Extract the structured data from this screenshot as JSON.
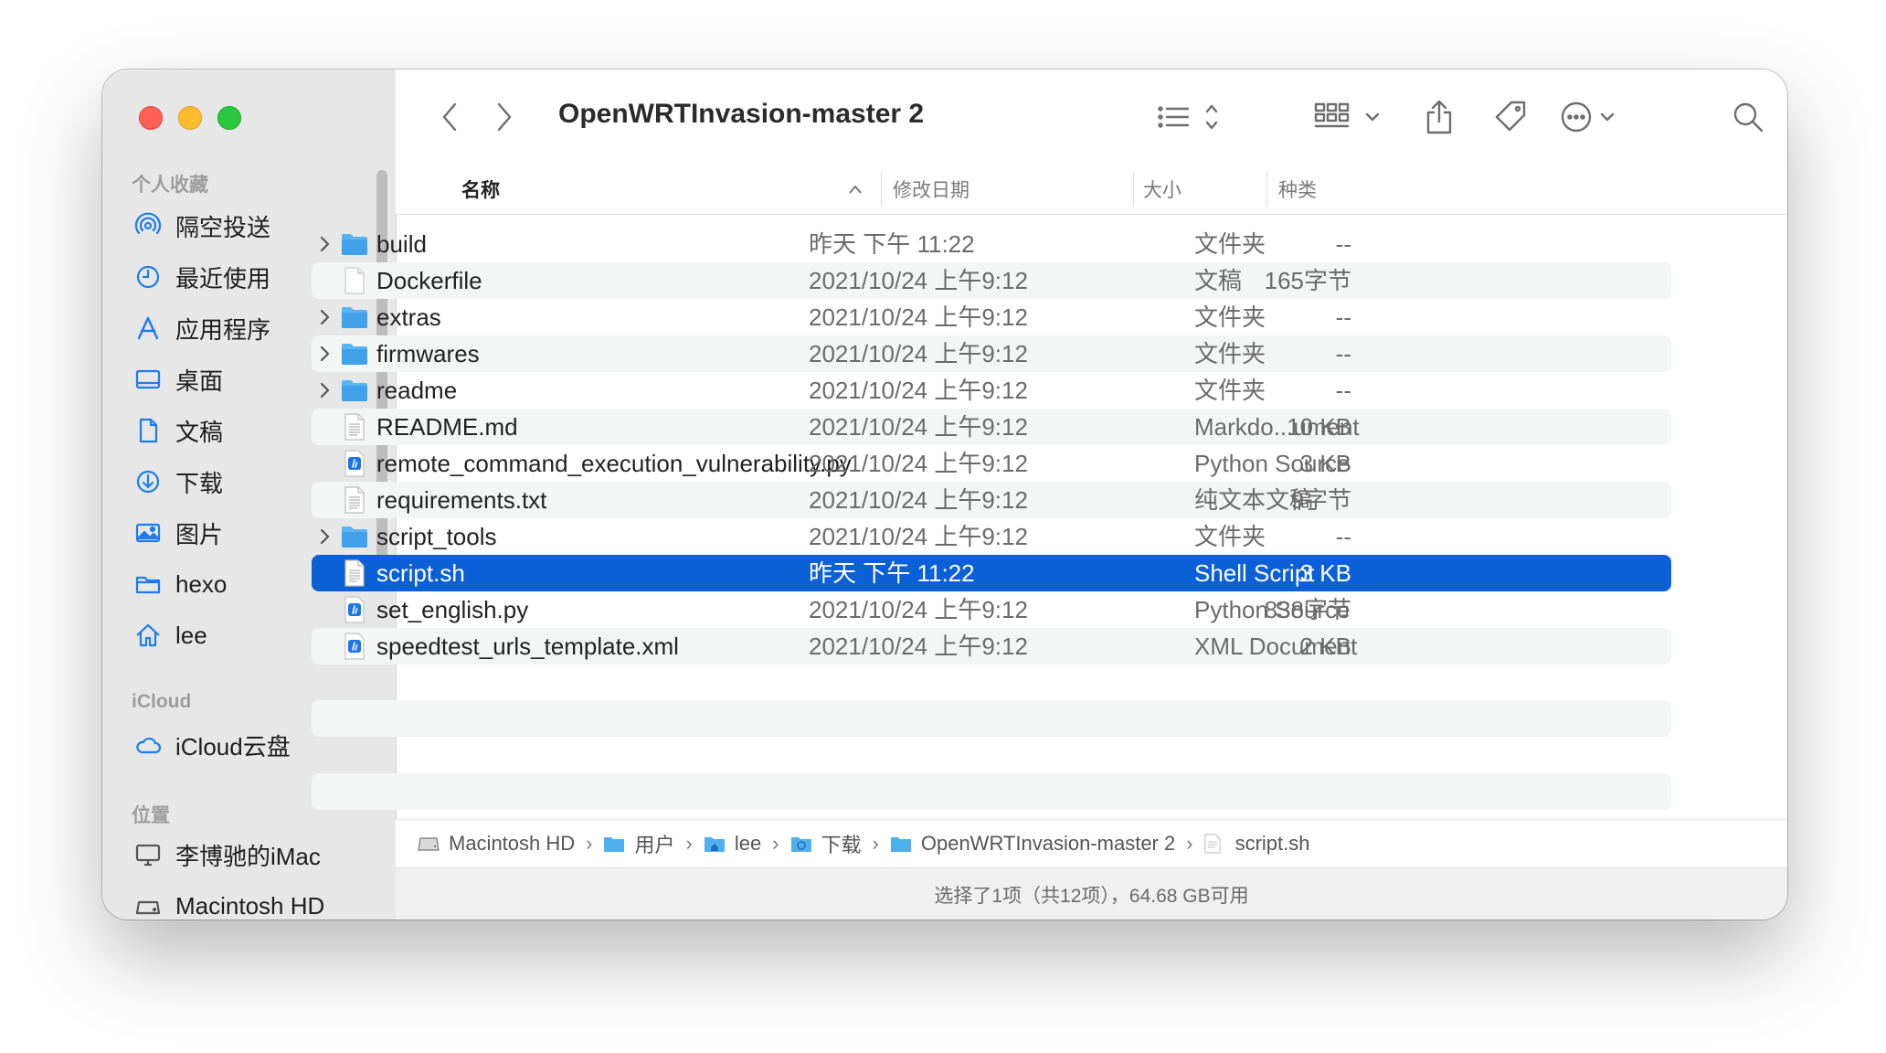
{
  "window": {
    "title": "OpenWRTInvasion-master 2"
  },
  "sidebar": {
    "sections": [
      {
        "label": "个人收藏"
      },
      {
        "label": "iCloud"
      },
      {
        "label": "位置"
      }
    ],
    "favorites": [
      {
        "label": "隔空投送",
        "icon": "airdrop-icon"
      },
      {
        "label": "最近使用",
        "icon": "clock-icon"
      },
      {
        "label": "应用程序",
        "icon": "applications-icon"
      },
      {
        "label": "桌面",
        "icon": "desktop-icon"
      },
      {
        "label": "文稿",
        "icon": "document-icon"
      },
      {
        "label": "下载",
        "icon": "download-icon"
      },
      {
        "label": "图片",
        "icon": "photos-icon"
      },
      {
        "label": "hexo",
        "icon": "folder-icon"
      },
      {
        "label": "lee",
        "icon": "home-icon"
      }
    ],
    "icloud": [
      {
        "label": "iCloud云盘",
        "icon": "cloud-icon"
      }
    ],
    "locations": [
      {
        "label": "李博驰的iMac",
        "icon": "computer-icon"
      },
      {
        "label": "Macintosh HD",
        "icon": "disk-icon"
      }
    ]
  },
  "columns": {
    "name": "名称",
    "date": "修改日期",
    "size": "大小",
    "kind": "种类"
  },
  "files": [
    {
      "name": "build",
      "date": "昨天 下午 11:22",
      "size": "--",
      "kind": "文件夹",
      "type": "folder",
      "selected": false
    },
    {
      "name": "Dockerfile",
      "date": "2021/10/24 上午9:12",
      "size": "165字节",
      "kind": "文稿",
      "type": "blank",
      "selected": false
    },
    {
      "name": "extras",
      "date": "2021/10/24 上午9:12",
      "size": "--",
      "kind": "文件夹",
      "type": "folder",
      "selected": false
    },
    {
      "name": "firmwares",
      "date": "2021/10/24 上午9:12",
      "size": "--",
      "kind": "文件夹",
      "type": "folder",
      "selected": false
    },
    {
      "name": "readme",
      "date": "2021/10/24 上午9:12",
      "size": "--",
      "kind": "文件夹",
      "type": "folder",
      "selected": false
    },
    {
      "name": "README.md",
      "date": "2021/10/24 上午9:12",
      "size": "10 KB",
      "kind": "Markdo...ument",
      "type": "text",
      "selected": false
    },
    {
      "name": "remote_command_execution_vulnerability.py",
      "date": "2021/10/24 上午9:12",
      "size": "3 KB",
      "kind": "Python Source",
      "type": "code",
      "selected": false
    },
    {
      "name": "requirements.txt",
      "date": "2021/10/24 上午9:12",
      "size": "9字节",
      "kind": "纯文本文稿",
      "type": "text",
      "selected": false
    },
    {
      "name": "script_tools",
      "date": "2021/10/24 上午9:12",
      "size": "--",
      "kind": "文件夹",
      "type": "folder",
      "selected": false
    },
    {
      "name": "script.sh",
      "date": "昨天 下午 11:22",
      "size": "3 KB",
      "kind": "Shell Script",
      "type": "text",
      "selected": true
    },
    {
      "name": "set_english.py",
      "date": "2021/10/24 上午9:12",
      "size": "838字节",
      "kind": "Python Source",
      "type": "code",
      "selected": false
    },
    {
      "name": "speedtest_urls_template.xml",
      "date": "2021/10/24 上午9:12",
      "size": "2 KB",
      "kind": "XML Document",
      "type": "code",
      "selected": false
    }
  ],
  "pathbar": [
    {
      "label": "Macintosh HD",
      "icon": "disk-icon"
    },
    {
      "label": "用户",
      "icon": "folder-icon"
    },
    {
      "label": "lee",
      "icon": "home-folder-icon"
    },
    {
      "label": "下载",
      "icon": "download-folder-icon"
    },
    {
      "label": "OpenWRTInvasion-master 2",
      "icon": "folder-icon"
    },
    {
      "label": "script.sh",
      "icon": "text-file-icon"
    }
  ],
  "status": "选择了1项（共12项），64.68 GB可用",
  "colors": {
    "accent": "#0b5fd7",
    "folder": "#4fb0f0"
  }
}
